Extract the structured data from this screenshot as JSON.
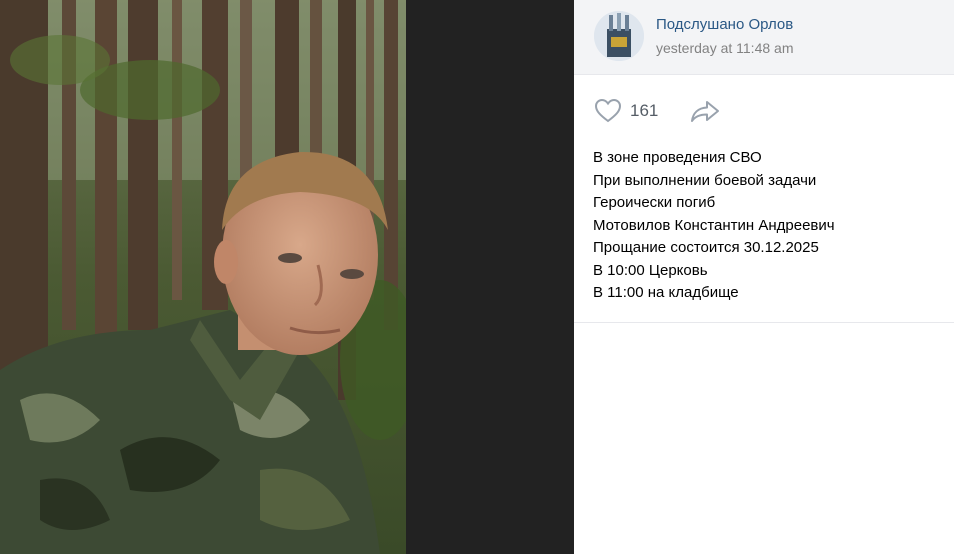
{
  "post": {
    "group_name": "Подслушано Орлов",
    "time": "yesterday at 11:48 am",
    "likes": "161",
    "text_lines": [
      "В зоне проведения СВО",
      "При выполнении боевой задачи",
      "Героически погиб",
      "Мотовилов Константин Андреевич",
      "Прощание состоится 30.12.2025",
      "В 10:00 Церковь",
      "В 11:00 на кладбище"
    ]
  },
  "icons": {
    "like": "heart-icon",
    "share": "share-arrow-icon",
    "avatar": "group-avatar-icon"
  },
  "colors": {
    "link": "#2a5885",
    "meta": "#828282",
    "viewer_bg": "#222222",
    "header_bg": "#f3f4f6"
  }
}
